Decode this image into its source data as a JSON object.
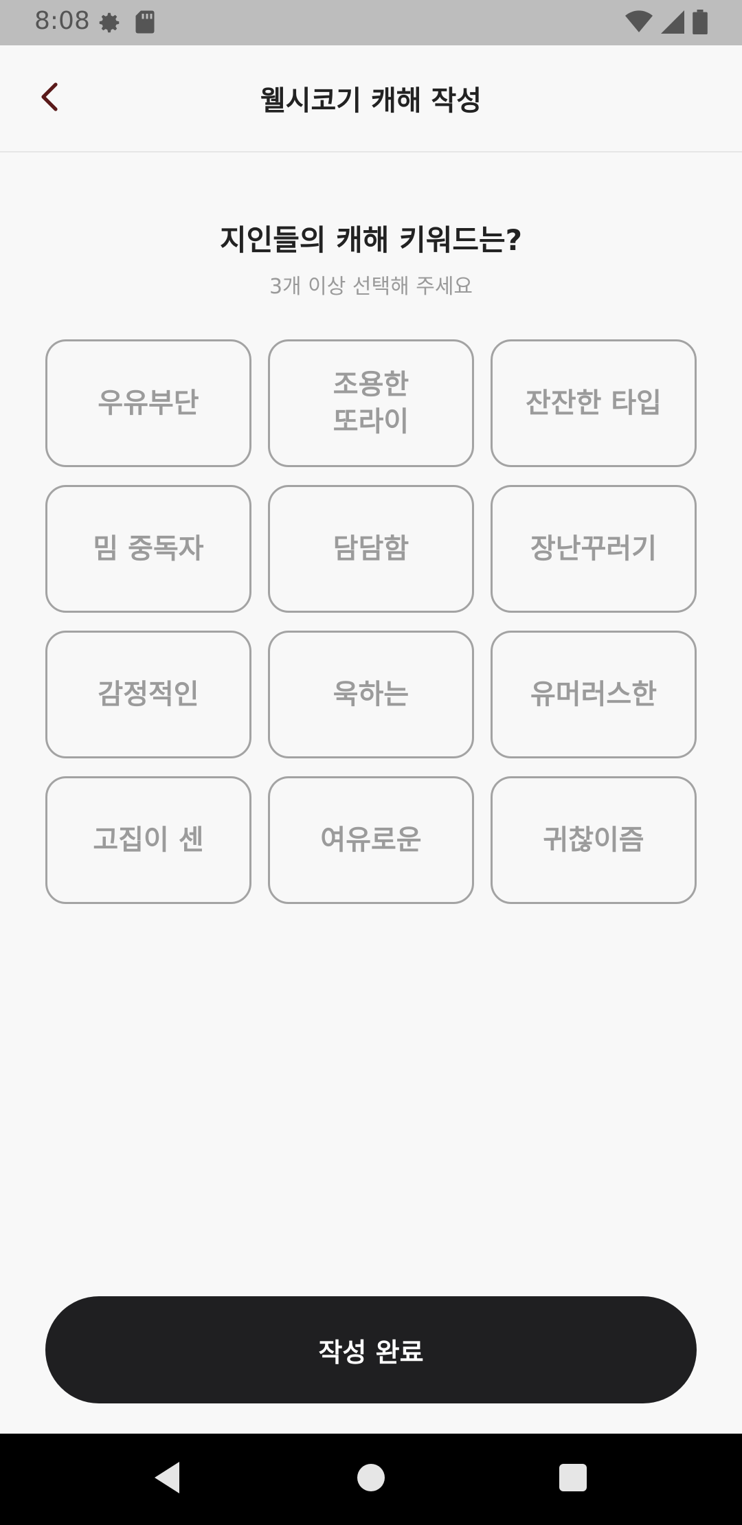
{
  "status_bar": {
    "time": "8:08",
    "left_icons": [
      "settings-gear-icon",
      "sd-card-icon"
    ],
    "right_icons": [
      "wifi-icon",
      "cell-signal-icon",
      "battery-icon"
    ]
  },
  "header": {
    "title": "웰시코기 캐해 작성",
    "back_icon": "chevron-left-icon",
    "back_color": "#5a1a1a"
  },
  "prompt": {
    "question": "지인들의 캐해 키워드는?",
    "subtitle": "3개 이상 선택해 주세요"
  },
  "keywords": [
    {
      "label": "우유부단",
      "selected": false
    },
    {
      "label": "조용한\n또라이",
      "selected": false
    },
    {
      "label": "잔잔한 타입",
      "selected": false
    },
    {
      "label": "밈 중독자",
      "selected": false
    },
    {
      "label": "담담함",
      "selected": false
    },
    {
      "label": "장난꾸러기",
      "selected": false
    },
    {
      "label": "감정적인",
      "selected": false
    },
    {
      "label": "욱하는",
      "selected": false
    },
    {
      "label": "유머러스한",
      "selected": false
    },
    {
      "label": "고집이 센",
      "selected": false
    },
    {
      "label": "여유로운",
      "selected": false
    },
    {
      "label": "귀찮이즘",
      "selected": false
    }
  ],
  "submit": {
    "label": "작성 완료",
    "background": "#1f1f21"
  },
  "nav_bar": {
    "buttons": [
      "back-triangle-icon",
      "home-circle-icon",
      "recents-square-icon"
    ]
  }
}
